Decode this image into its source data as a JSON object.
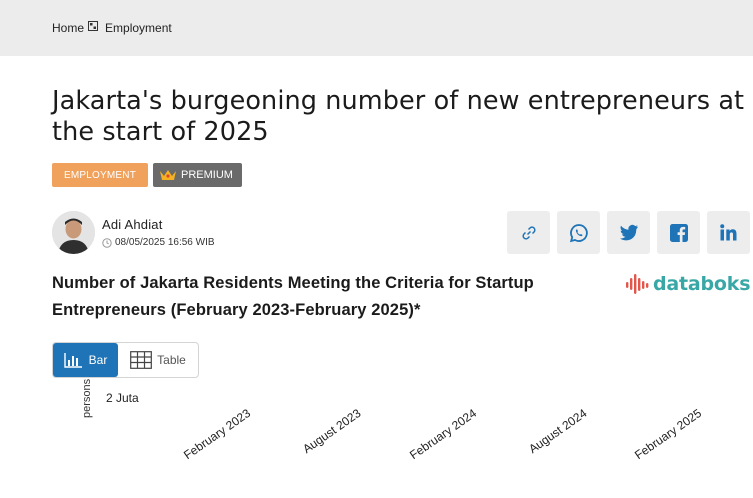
{
  "breadcrumb": {
    "home": "Home",
    "section": "Employment"
  },
  "article": {
    "title": "Jakarta's burgeoning number of new entrepreneurs at the start of 2025",
    "tags": {
      "category": "EMPLOYMENT",
      "premium": "PREMIUM"
    },
    "author": {
      "name": "Adi Ahdiat",
      "date": "08/05/2025 16:56 WIB"
    }
  },
  "share": [
    "link-icon",
    "whatsapp-icon",
    "twitter-icon",
    "facebook-icon",
    "linkedin-icon"
  ],
  "logo": {
    "text": "databoks"
  },
  "chart_section": {
    "title": "Number of Jakarta Residents Meeting the Criteria for Startup Entrepreneurs (February 2023-February 2025)*",
    "toggle": {
      "bar": "Bar",
      "table": "Table"
    }
  },
  "chart_data": {
    "type": "bar",
    "ylabel": "persons",
    "yticks": [
      "2 Juta"
    ],
    "categories": [
      "February 2023",
      "August 2023",
      "February 2024",
      "August 2024",
      "February 2025"
    ]
  },
  "colors": {
    "accent": "#1f74b7",
    "employment_tag": "#f0a15c",
    "premium_tag": "#6a6a6a",
    "logo": "#3aa7a7"
  }
}
